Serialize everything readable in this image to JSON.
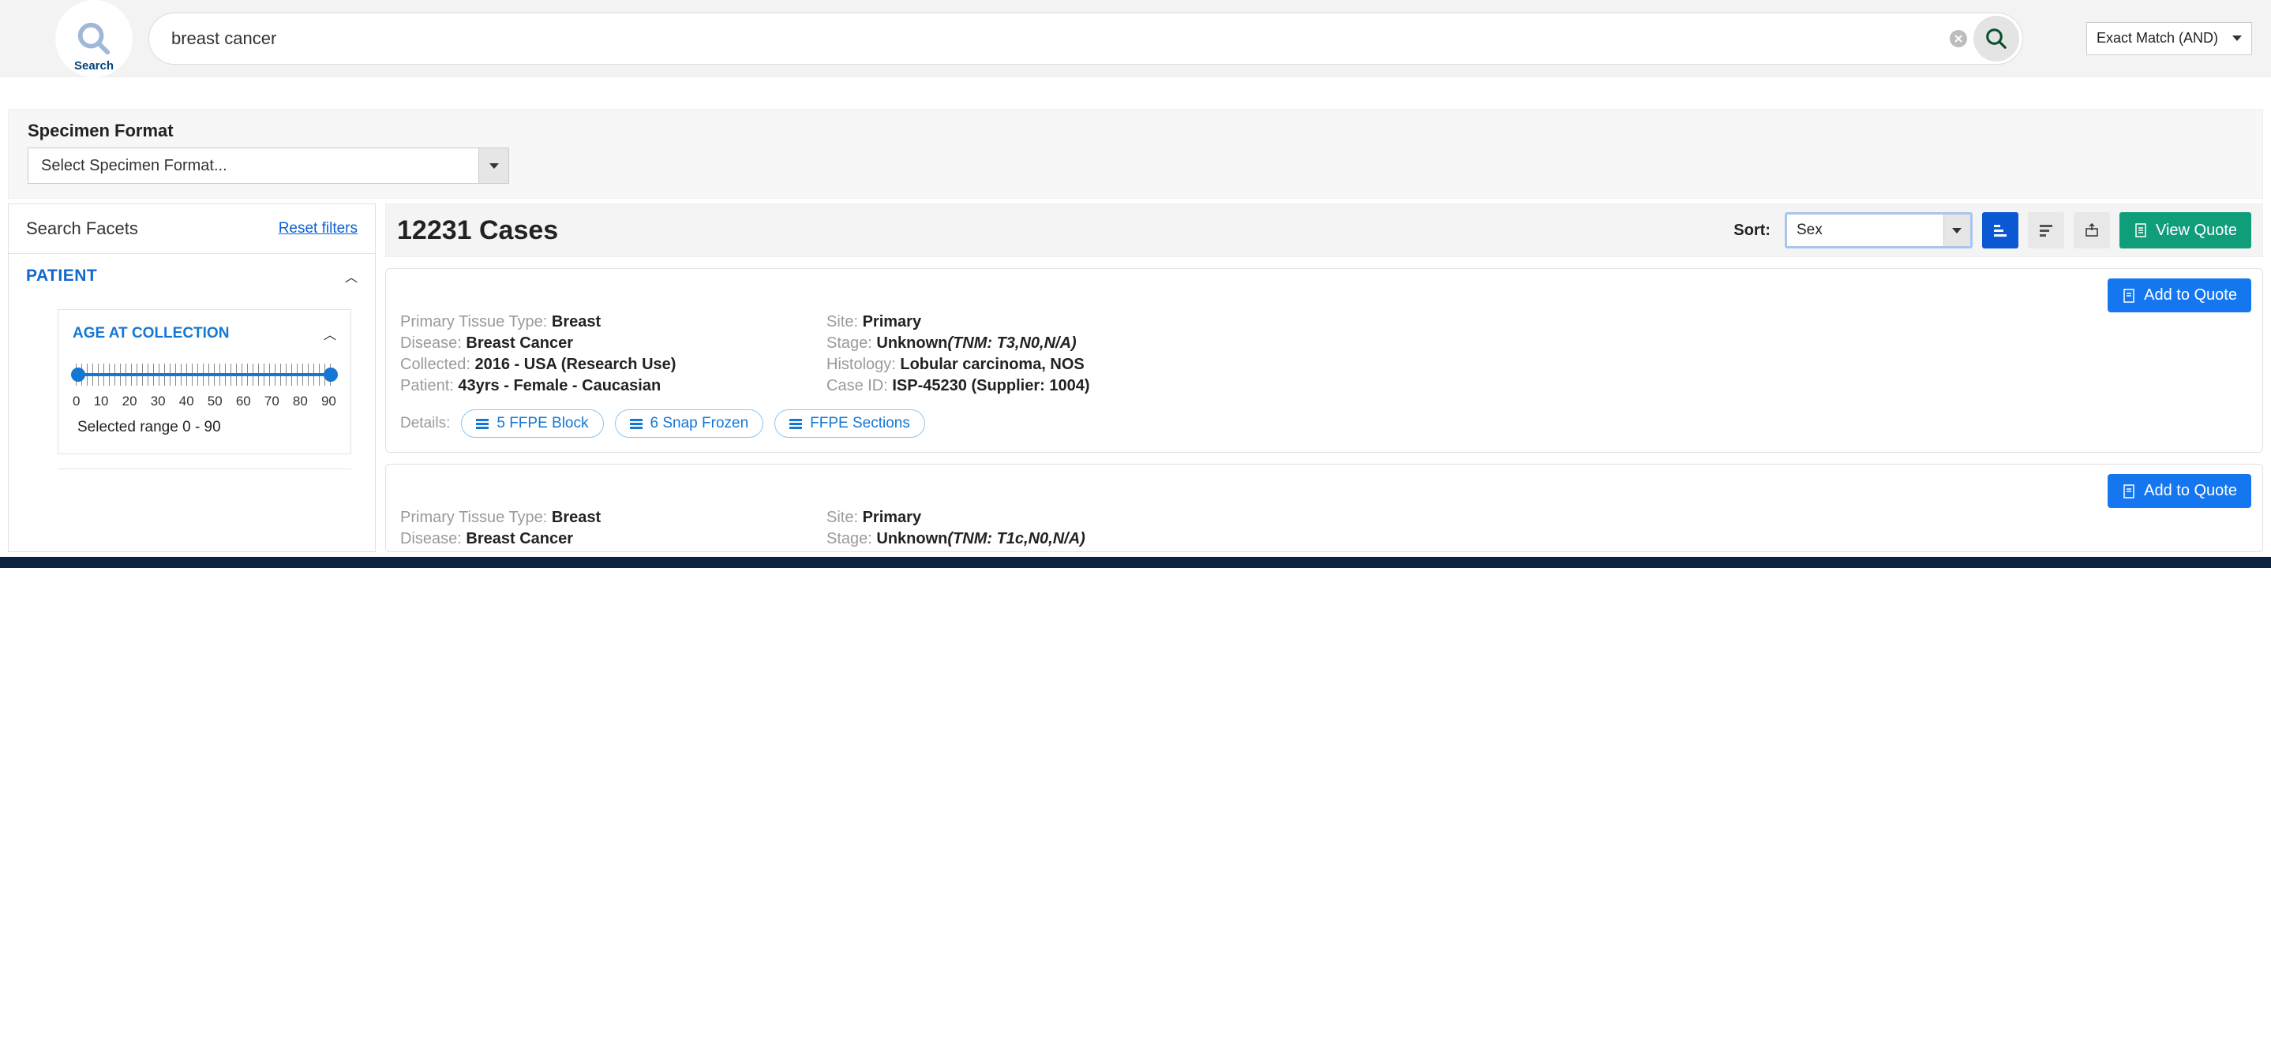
{
  "top": {
    "search_tab_label": "Search",
    "search_value": "breast cancer",
    "match_mode": "Exact Match (AND)"
  },
  "specimen": {
    "label": "Specimen Format",
    "placeholder": "Select Specimen Format..."
  },
  "facets": {
    "title": "Search Facets",
    "reset": "Reset filters",
    "patient_group": "PATIENT",
    "age_facet": {
      "title": "AGE AT COLLECTION",
      "ticks": [
        "0",
        "10",
        "20",
        "30",
        "40",
        "50",
        "60",
        "70",
        "80",
        "90"
      ],
      "selected_text": "Selected range 0 - 90"
    }
  },
  "results": {
    "count_text": "12231 Cases",
    "sort_label": "Sort:",
    "sort_value": "Sex",
    "view_quote": "View Quote",
    "add_to_quote": "Add to Quote",
    "details_label": "Details:",
    "cases": [
      {
        "tissue": "Breast",
        "disease": "Breast Cancer",
        "collected": "2016 - USA (Research Use)",
        "patient": "43yrs - Female - Caucasian",
        "site": "Primary",
        "stage_main": "Unknown",
        "stage_tnm": "(TNM: T3,N0,N/A)",
        "histology": "Lobular carcinoma, NOS",
        "case_id": "ISP-45230 (Supplier: 1004)",
        "chips": [
          "5 FFPE Block",
          "6 Snap Frozen",
          "FFPE Sections"
        ]
      },
      {
        "tissue": "Breast",
        "disease": "Breast Cancer",
        "site": "Primary",
        "stage_main": "Unknown",
        "stage_tnm": "(TNM: T1c,N0,N/A)"
      }
    ],
    "field_labels": {
      "tissue": "Primary Tissue Type:",
      "disease": "Disease:",
      "collected": "Collected:",
      "patient": "Patient:",
      "site": "Site:",
      "stage": "Stage:",
      "histology": "Histology:",
      "case_id": "Case ID:"
    }
  }
}
